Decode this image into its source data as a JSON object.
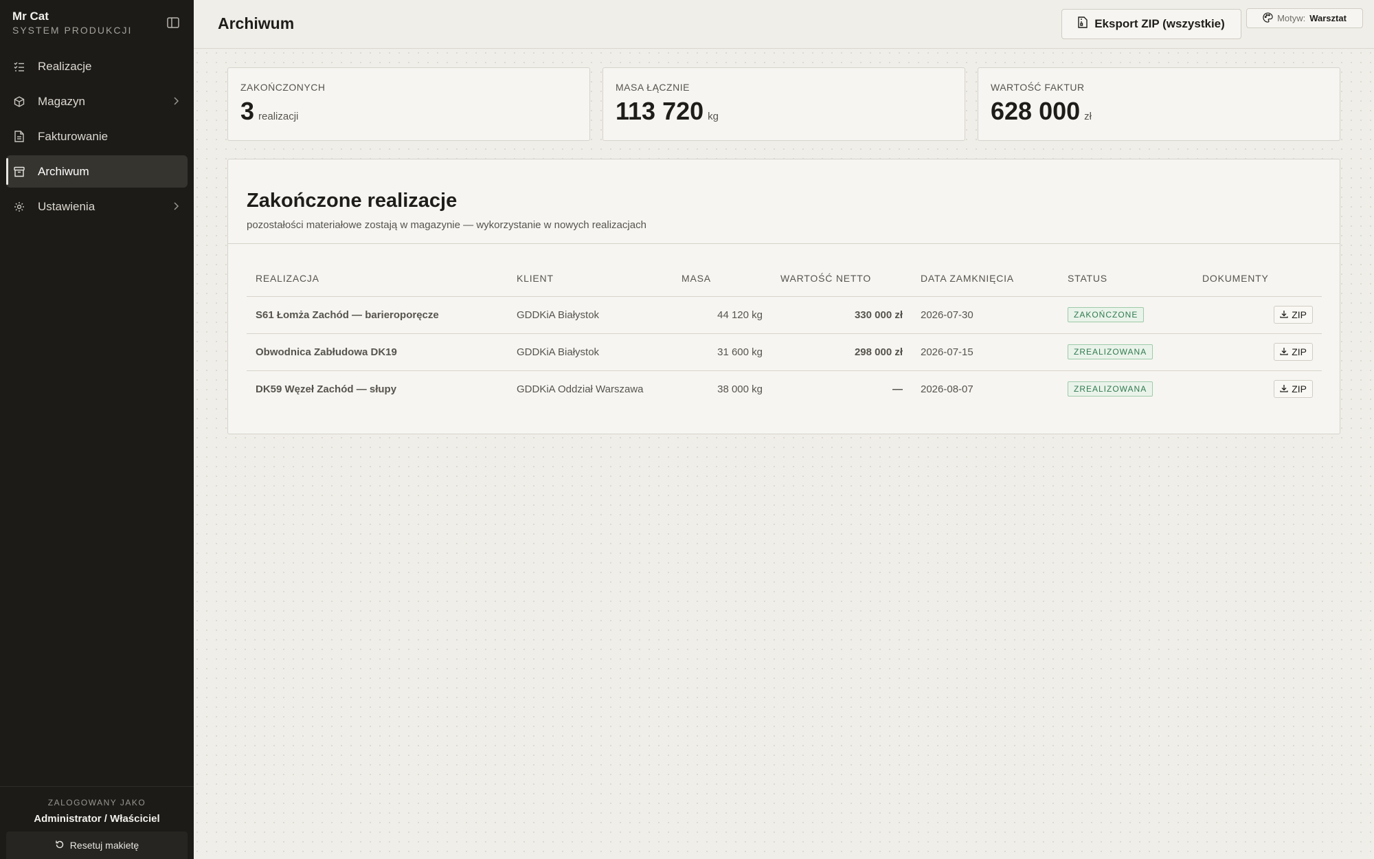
{
  "sidebar": {
    "brand_name": "Mr Cat",
    "brand_subtitle": "SYSTEM PRODUKCJI",
    "items": [
      {
        "label": "Realizacje",
        "icon": "list-check-icon",
        "has_chevron": false,
        "active": false
      },
      {
        "label": "Magazyn",
        "icon": "package-icon",
        "has_chevron": true,
        "active": false
      },
      {
        "label": "Fakturowanie",
        "icon": "document-icon",
        "has_chevron": false,
        "active": false
      },
      {
        "label": "Archiwum",
        "icon": "archive-icon",
        "has_chevron": false,
        "active": true
      },
      {
        "label": "Ustawienia",
        "icon": "gear-icon",
        "has_chevron": true,
        "active": false
      }
    ],
    "footer": {
      "logged_label": "ZALOGOWANY JAKO",
      "user": "Administrator / Właściciel",
      "reset_label": "Resetuj makietę"
    }
  },
  "header": {
    "title": "Archiwum",
    "export_label": "Eksport ZIP (wszystkie)",
    "theme_label": "Motyw:",
    "theme_value": "Warsztat"
  },
  "stats": [
    {
      "label": "ZAKOŃCZONYCH",
      "value": "3",
      "unit": "realizacji"
    },
    {
      "label": "MASA ŁĄCZNIE",
      "value": "113 720",
      "unit": "kg"
    },
    {
      "label": "WARTOŚĆ FAKTUR",
      "value": "628 000",
      "unit": "zł"
    }
  ],
  "table": {
    "title": "Zakończone realizacje",
    "subtitle": "pozostałości materiałowe zostają w magazynie — wykorzystanie w nowych realizacjach",
    "columns": {
      "realizacja": "REALIZACJA",
      "klient": "KLIENT",
      "masa": "MASA",
      "wartosc": "WARTOŚĆ NETTO",
      "data": "DATA ZAMKNIĘCIA",
      "status": "STATUS",
      "dokumenty": "DOKUMENTY"
    },
    "rows": [
      {
        "name": "S61 Łomża Zachód — barieroporęcze",
        "client": "GDDKiA Białystok",
        "mass": "44 120 kg",
        "netto": "330 000 zł",
        "date": "2026-07-30",
        "status": "ZAKOŃCZONE",
        "doc": "ZIP"
      },
      {
        "name": "Obwodnica Zabłudowa DK19",
        "client": "GDDKiA Białystok",
        "mass": "31 600 kg",
        "netto": "298 000 zł",
        "date": "2026-07-15",
        "status": "ZREALIZOWANA",
        "doc": "ZIP"
      },
      {
        "name": "DK59 Węzeł Zachód — słupy",
        "client": "GDDKiA Oddział Warszawa",
        "mass": "38 000 kg",
        "netto": "—",
        "date": "2026-08-07",
        "status": "ZREALIZOWANA",
        "doc": "ZIP"
      }
    ]
  },
  "colors": {
    "sidebar_bg": "#1c1b18",
    "page_bg": "#efeee8",
    "status_green": "#2f7a4f"
  }
}
